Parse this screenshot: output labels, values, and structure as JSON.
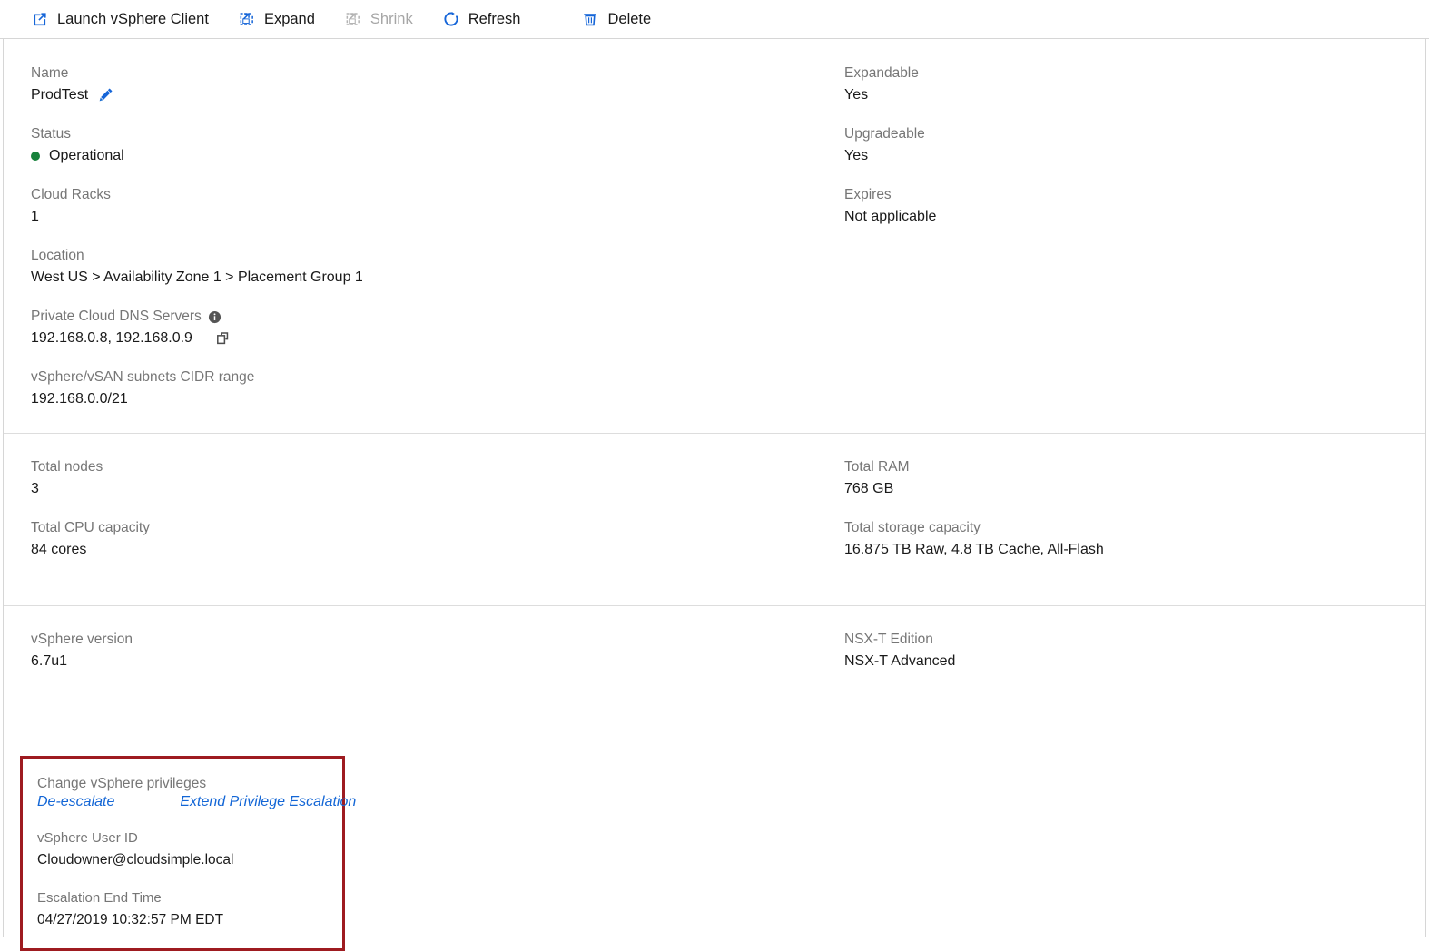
{
  "toolbar": {
    "buttons": [
      {
        "label": "Launch vSphere Client",
        "icon": "external-link-icon",
        "disabled": false
      },
      {
        "label": "Expand",
        "icon": "expand-icon",
        "disabled": false
      },
      {
        "label": "Shrink",
        "icon": "shrink-icon",
        "disabled": true
      },
      {
        "label": "Refresh",
        "icon": "refresh-icon",
        "disabled": false
      },
      {
        "label": "Delete",
        "icon": "trash-icon",
        "disabled": false
      }
    ]
  },
  "overview": {
    "left": [
      {
        "label": "Name",
        "value": "ProdTest",
        "icon": "edit-pencil-icon"
      },
      {
        "label": "Status",
        "value": "Operational",
        "status_color": "#17823b"
      },
      {
        "label": "Cloud Racks",
        "value": "1"
      },
      {
        "label": "Location",
        "value": "West US > Availability Zone 1 > Placement Group 1"
      },
      {
        "label": "Private Cloud DNS Servers",
        "value": "192.168.0.8, 192.168.0.9",
        "label_icon": "info-icon",
        "value_icon": "copy-icon"
      },
      {
        "label": "vSphere/vSAN subnets CIDR range",
        "value": "192.168.0.0/21"
      }
    ],
    "right": [
      {
        "label": "Expandable",
        "value": "Yes"
      },
      {
        "label": "Upgradeable",
        "value": "Yes"
      },
      {
        "label": "Expires",
        "value": "Not applicable"
      }
    ]
  },
  "capacity": {
    "left": [
      {
        "label": "Total nodes",
        "value": "3"
      },
      {
        "label": "Total CPU capacity",
        "value": "84 cores"
      }
    ],
    "right": [
      {
        "label": "Total RAM",
        "value": "768 GB"
      },
      {
        "label": "Total storage capacity",
        "value": "16.875 TB Raw, 4.8 TB Cache, All-Flash"
      }
    ]
  },
  "versions": {
    "left": [
      {
        "label": "vSphere version",
        "value": "6.7u1"
      }
    ],
    "right": [
      {
        "label": "NSX-T Edition",
        "value": "NSX-T Advanced"
      }
    ]
  },
  "privileges": {
    "highlight_color": "#9e1b20",
    "link_color": "#1366d6",
    "change_label": "Change vSphere privileges",
    "link_deescalate": "De-escalate",
    "link_extend": "Extend Privilege Escalation",
    "user_id_label": "vSphere User ID",
    "user_id_value": "Cloudowner@cloudsimple.local",
    "end_time_label": "Escalation End Time",
    "end_time_value": "04/27/2019 10:32:57 PM EDT"
  }
}
